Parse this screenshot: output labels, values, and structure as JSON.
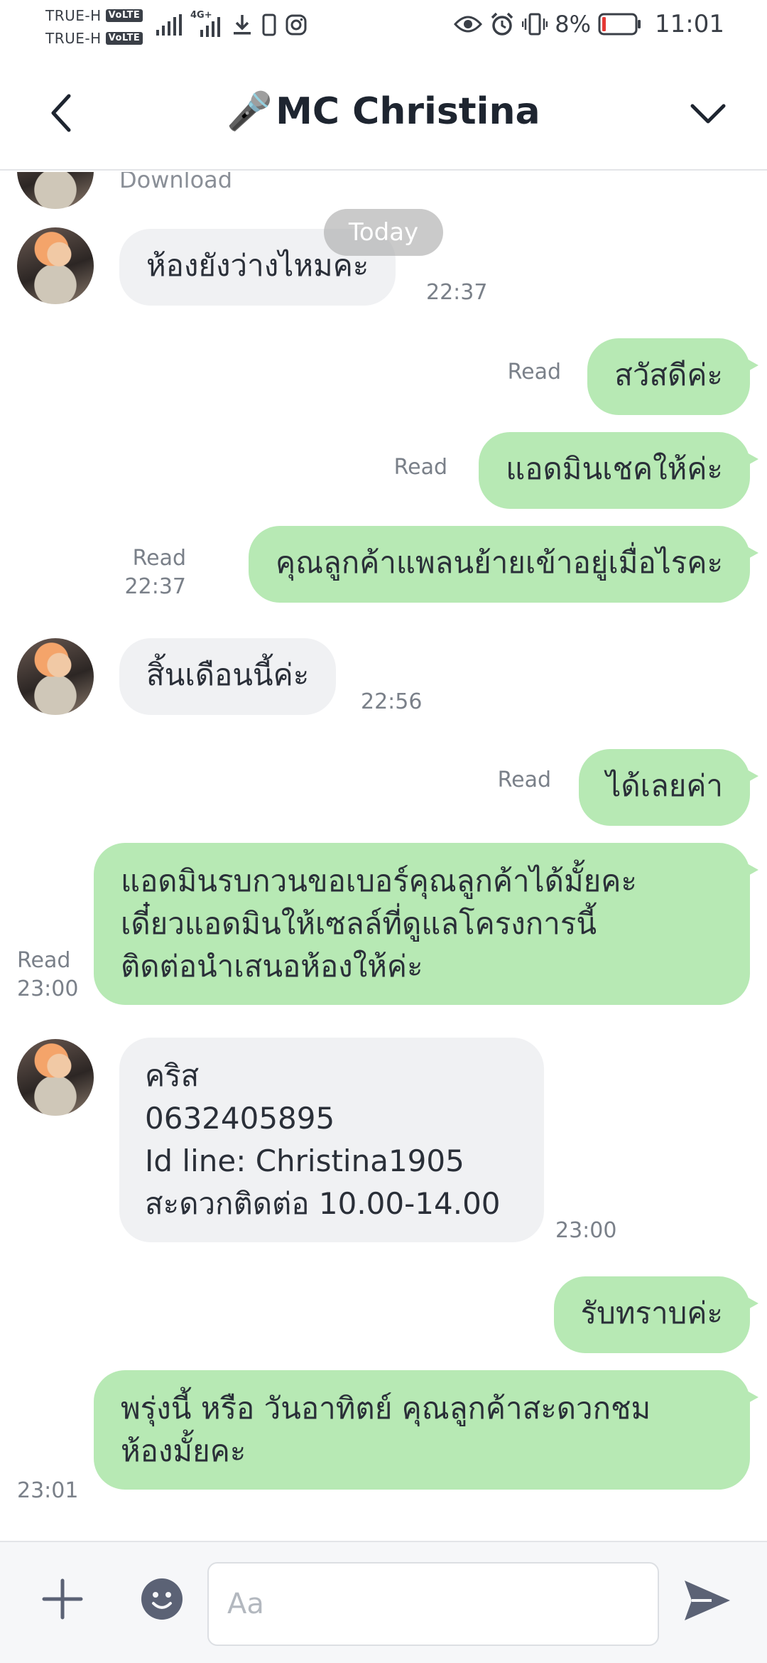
{
  "status_bar": {
    "carrier1": "TRUE-H",
    "carrier2": "TRUE-H",
    "volte": "VoLTE",
    "network": "4G+",
    "battery": "8%",
    "time": "11:01"
  },
  "header": {
    "title_emoji": "🎤",
    "title": "MC Christina"
  },
  "chat": {
    "download_label": "Download",
    "today_label": "Today",
    "messages": [
      {
        "side": "in",
        "text": "ห้องยังว่างไหมคะ",
        "time": "22:37"
      },
      {
        "side": "out",
        "text": "สวัสดีค่ะ",
        "status": "Read"
      },
      {
        "side": "out",
        "text": "แอดมินเชคให้ค่ะ",
        "status": "Read"
      },
      {
        "side": "out",
        "text": "คุณลูกค้าแพลนย้ายเข้าอยู่เมื่อไรคะ",
        "status": "Read",
        "time": "22:37"
      },
      {
        "side": "in",
        "text": "สิ้นเดือนนี้ค่ะ",
        "time": "22:56"
      },
      {
        "side": "out",
        "text": "ได้เลยค่า",
        "status": "Read"
      },
      {
        "side": "out",
        "lines": [
          "แอดมินรบกวนขอเบอร์คุณลูกค้าได้มั้ยคะ",
          "เดี๋ยวแอดมินให้เซลล์ที่ดูแลโครงการนี้",
          "ติดต่อนำเสนอห้องให้ค่ะ"
        ],
        "status": "Read",
        "time": "23:00"
      },
      {
        "side": "in",
        "lines": [
          "คริส",
          "0632405895",
          "Id line: Christina1905",
          "สะดวกติดต่อ 10.00-14.00"
        ],
        "time": "23:00"
      },
      {
        "side": "out",
        "text": "รับทราบค่ะ"
      },
      {
        "side": "out",
        "lines": [
          "พรุ่งนี้ หรือ วันอาทิตย์ คุณลูกค้าสะดวกชม",
          "ห้องมั้ยคะ"
        ],
        "time": "23:01"
      }
    ]
  },
  "input": {
    "placeholder": "Aa"
  },
  "colors": {
    "outgoing_bubble": "#b7e9b4",
    "incoming_bubble": "#f0f1f3",
    "icon": "#5b6275",
    "battery_low": "#e53935"
  }
}
